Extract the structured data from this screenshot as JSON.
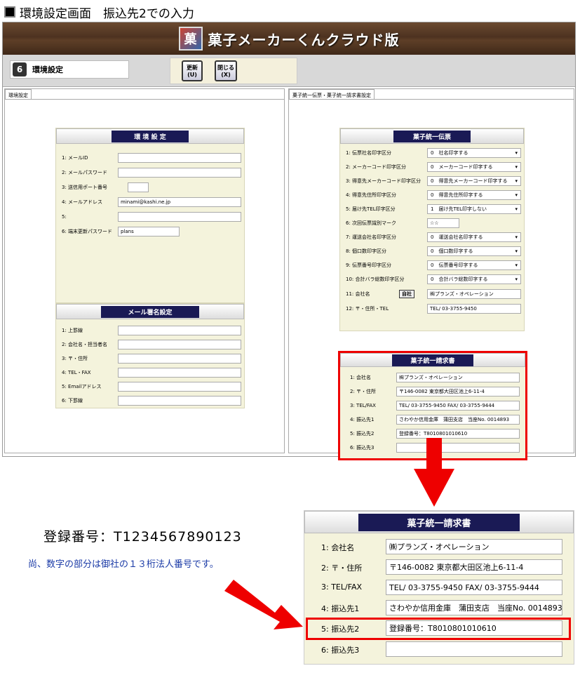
{
  "page": {
    "title": "環境設定画面　振込先2での入力"
  },
  "app": {
    "logo_text": "菓",
    "title": "菓子メーカーくんクラウド版",
    "caption": "環境設定",
    "caption_icon": "6",
    "buttons": {
      "update": {
        "label": "更新",
        "key": "(U)"
      },
      "close": {
        "label": "閉じる",
        "key": "(X)"
      }
    }
  },
  "left_panel": {
    "tab": "環境設定",
    "env": {
      "header": "環 境 設 定",
      "rows": [
        {
          "label": "1: メールID",
          "value": ""
        },
        {
          "label": "2: メールパスワード",
          "value": ""
        },
        {
          "label": "3: 送信用ポート番号",
          "value": ""
        },
        {
          "label": "4: メールアドレス",
          "value": "minami@kashi.ne.jp"
        },
        {
          "label": "5:",
          "value": ""
        },
        {
          "label": "6: 端末更新パスワード",
          "value": "plans"
        }
      ]
    },
    "mail": {
      "header": "メール署名設定",
      "rows": [
        {
          "label": "1: 上罫線",
          "value": ""
        },
        {
          "label": "2: 会社名・担当者名",
          "value": ""
        },
        {
          "label": "3: 〒・住所",
          "value": ""
        },
        {
          "label": "4: TEL・FAX",
          "value": ""
        },
        {
          "label": "5: Emailアドレス",
          "value": ""
        },
        {
          "label": "6: 下罫線",
          "value": ""
        }
      ]
    }
  },
  "right_panel": {
    "tab": "菓子統一伝票・菓子統一請求書設定",
    "denpyo": {
      "header": "菓子統一伝票",
      "jisha": "自社",
      "rows": [
        {
          "label": "1: 伝票社名印字区分",
          "value": "0　社名印字する"
        },
        {
          "label": "2: メーカーコード印字区分",
          "value": "0　メーカーコード印字する"
        },
        {
          "label": "3: 得意先メーカーコード印字区分",
          "value": "0　得意先メーカーコード印字する"
        },
        {
          "label": "4: 得意先住所印字区分",
          "value": "0　得意先住所印字する"
        },
        {
          "label": "5: 届け先TEL印字区分",
          "value": "1　届け先TEL印字しない"
        },
        {
          "label": "6: 次回伝票識別マーク",
          "value": "☆☆"
        },
        {
          "label": "7: 運送会社名印字区分",
          "value": "0　運送会社名印字する"
        },
        {
          "label": "8: 個口数印字区分",
          "value": "0　個口数印字する"
        },
        {
          "label": "9: 伝票番号印字区分",
          "value": "0　伝票番号印字する"
        },
        {
          "label": "10: 合計バラ総数印字区分",
          "value": "0　合計バラ総数印字する"
        },
        {
          "label": "11: 会社名",
          "value": "㈱プランズ・オペレーション"
        },
        {
          "label": "12: 〒・住所・TEL",
          "value": "TEL/ 03-3755-9450"
        }
      ]
    },
    "seikyu": {
      "header": "菓子統一請求書",
      "rows": [
        {
          "label": "1: 会社名",
          "value": "㈱プランズ・オペレーション"
        },
        {
          "label": "2: 〒・住所",
          "value": "〒146-0082 東京都大田区池上6-11-4"
        },
        {
          "label": "3: TEL/FAX",
          "value": "TEL/ 03-3755-9450 FAX/ 03-3755-9444"
        },
        {
          "label": "4: 振込先1",
          "value": "さわやか信用金庫　蒲田支店　当座No. 0014893"
        },
        {
          "label": "5: 振込先2",
          "value": "登録番号：T8010801010610"
        },
        {
          "label": "6: 振込先3",
          "value": ""
        }
      ]
    }
  },
  "callout": {
    "registration": "登録番号：T1234567890123",
    "note": "尚、数字の部分は御社の１３桁法人番号です。"
  },
  "colors": {
    "highlight": "#e00000",
    "header_bg": "#1a1a55",
    "panel_bg": "#f4f3dc"
  }
}
